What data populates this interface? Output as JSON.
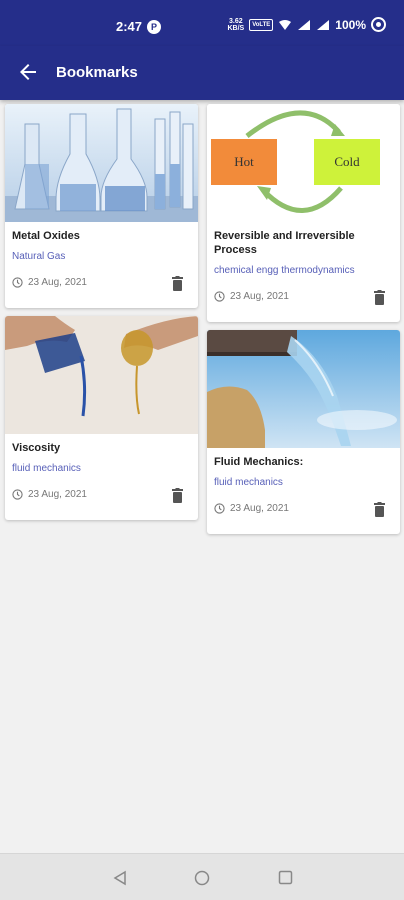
{
  "status_bar": {
    "time": "2:47",
    "indicator": "P",
    "net_speed": "3.62\nKB/S",
    "vol_label": "VoLTE",
    "battery": "100%"
  },
  "app_bar": {
    "title": "Bookmarks",
    "back_icon": "arrow-left-icon"
  },
  "bookmarks": [
    {
      "title": "Metal Oxides",
      "subject": "Natural Gas",
      "date": "23 Aug, 2021",
      "image": "lab-glassware"
    },
    {
      "title": "Reversible and Irreversible Process",
      "subject": "chemical engg thermodynamics",
      "date": "23 Aug, 2021",
      "image": "hot-cold-diagram",
      "image_text": {
        "hot": "Hot",
        "cold": "Cold"
      }
    },
    {
      "title": "Viscosity",
      "subject": "fluid mechanics",
      "date": "23 Aug, 2021",
      "image": "pouring-liquids"
    },
    {
      "title": "Fluid Mechanics:",
      "subject": "fluid mechanics",
      "date": "23 Aug, 2021",
      "image": "water-pipe"
    }
  ],
  "colors": {
    "primary": "#252e8a",
    "subject_link": "#5860b8",
    "hot": "#f28b3a",
    "cold": "#cef23a"
  },
  "nav_bar": {
    "back": "nav-back-icon",
    "home": "nav-home-icon",
    "recents": "nav-recents-icon"
  }
}
